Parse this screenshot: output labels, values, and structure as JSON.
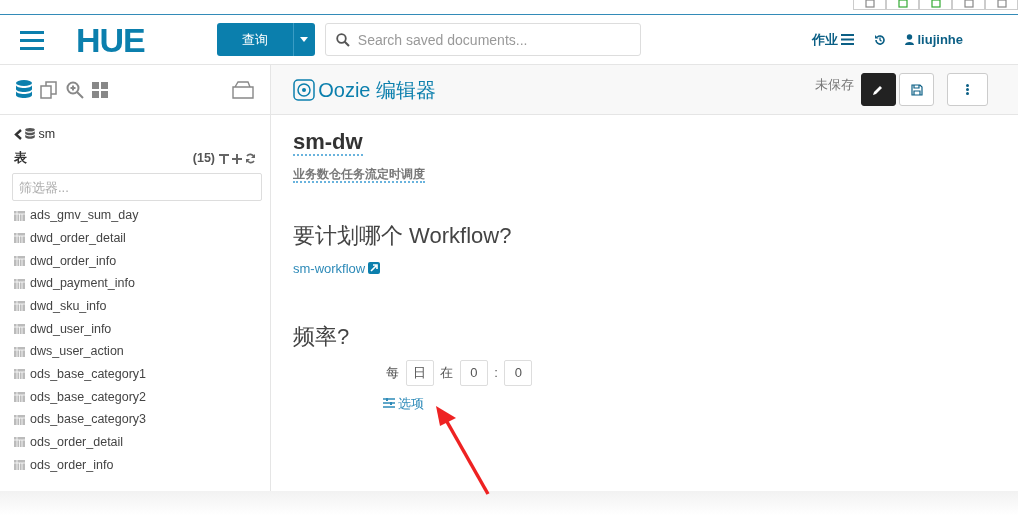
{
  "nav": {
    "logo": "HUE",
    "query_button": "查询",
    "search": {
      "placeholder": "Search saved documents..."
    },
    "jobs": "作业",
    "user": "liujinhe"
  },
  "sidebar": {
    "database": "sm",
    "section": "表",
    "count": "(15)",
    "filter": {
      "placeholder": "筛选器..."
    },
    "tables": [
      "ads_gmv_sum_day",
      "dwd_order_detail",
      "dwd_order_info",
      "dwd_payment_info",
      "dwd_sku_info",
      "dwd_user_info",
      "dws_user_action",
      "ods_base_category1",
      "ods_base_category2",
      "ods_base_category3",
      "ods_order_detail",
      "ods_order_info"
    ]
  },
  "editor": {
    "title": "Oozie 编辑器",
    "save_status": "未保存",
    "edit_selected": true
  },
  "schedule": {
    "name": "sm-dw",
    "description": "业务数仓任务流定时调度",
    "workflow_heading": "要计划哪个 Workflow?",
    "workflow_link": "sm-workflow",
    "frequency_heading": "频率?",
    "frequency_parts": [
      {
        "kind": "label",
        "text": "每"
      },
      {
        "kind": "field",
        "value": "日"
      },
      {
        "kind": "label",
        "text": "在"
      },
      {
        "kind": "field",
        "value": "0"
      },
      {
        "kind": "label",
        "text": ":"
      },
      {
        "kind": "field",
        "value": "0"
      }
    ],
    "options_link": "选项"
  }
}
